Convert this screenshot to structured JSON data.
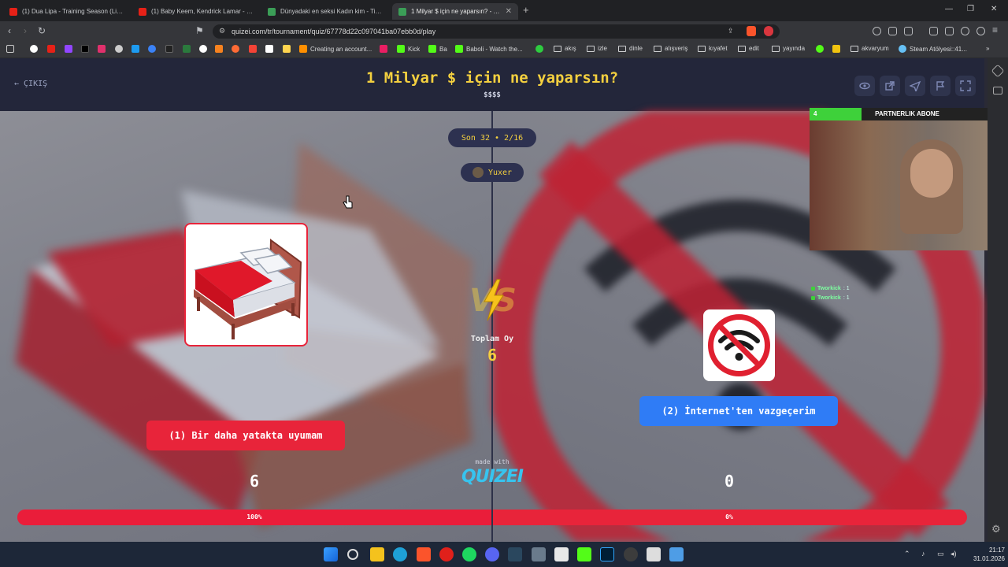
{
  "browser": {
    "tabs": [
      {
        "label": "(1) Dua Lipa - Training Season (Live f...",
        "active": false,
        "favicon_color": "#e62117"
      },
      {
        "label": "(1) Baby Keem, Kendrick Lamar - fam...",
        "active": false,
        "favicon_color": "#e62117"
      },
      {
        "label": "Dünyadaki en seksi Kadın kim - Tier l...",
        "active": false,
        "favicon_color": "#3b9e57"
      },
      {
        "label": "1 Milyar $ için ne yaparsın? - Tier",
        "active": true,
        "favicon_color": "#3b9e57"
      }
    ],
    "new_tab": "+",
    "url": "quizei.com/tr/tournament/quiz/67778d22c097041ba07ebb0d/play",
    "bookmarks": [
      {
        "label": "",
        "color": "#ffffff"
      },
      {
        "label": "",
        "color": "#e62117"
      },
      {
        "label": "",
        "color": "#9146ff"
      },
      {
        "label": "",
        "color": "#000000"
      },
      {
        "label": "",
        "color": "#e1306c"
      },
      {
        "label": "",
        "color": "#cccccc"
      },
      {
        "label": "",
        "color": "#1d9bf0"
      },
      {
        "label": "",
        "color": "#3b82f6"
      },
      {
        "label": "",
        "color": "#2b7a3d"
      },
      {
        "label": "",
        "color": "#000000"
      },
      {
        "label": "",
        "color": "#ffffff"
      },
      {
        "label": "",
        "color": "#f6821f"
      },
      {
        "label": "",
        "color": "#ff6b35"
      },
      {
        "label": "",
        "color": "#f44336"
      },
      {
        "label": "",
        "color": "#ffffff"
      },
      {
        "label": "",
        "color": "#ffd54f"
      },
      {
        "label": "Creating an account...",
        "color": "#ff8f00"
      },
      {
        "label": "",
        "color": "#e91e63"
      },
      {
        "label": "Kick",
        "color": "#53fc18"
      },
      {
        "label": "Ba",
        "color": "#53fc18"
      },
      {
        "label": "Baboli - Watch the...",
        "color": "#53fc18"
      },
      {
        "label": "",
        "color": "#2ecc40"
      },
      {
        "label": "akış",
        "folder": true
      },
      {
        "label": "izle",
        "folder": true
      },
      {
        "label": "dinle",
        "folder": true
      },
      {
        "label": "alışveriş",
        "folder": true
      },
      {
        "label": "kıyafet",
        "folder": true
      },
      {
        "label": "edit",
        "folder": true
      },
      {
        "label": "yayında",
        "folder": true
      },
      {
        "label": "",
        "color": "#53fc18"
      },
      {
        "label": "",
        "color": "#f1c40f"
      },
      {
        "label": "akvaryum",
        "folder": true
      },
      {
        "label": "Steam Atölyesi::41...",
        "color": "#66c0f4"
      }
    ]
  },
  "quiz": {
    "exit_label": "ÇIKIŞ",
    "title": "1 Milyar $ için ne yaparsın?",
    "subtitle": "$$$$",
    "round_label": "Son 32 • 2/16",
    "author": "Yuxer",
    "vs": "VS",
    "total_votes_label": "Toplam Oy",
    "total_votes": "6",
    "made_with": "made with",
    "logo": "QUIZEI",
    "left": {
      "label": "(1) Bir daha yatakta uyumam",
      "score": "6",
      "percent_label": "100%",
      "percent": 100,
      "color": "#e8243a"
    },
    "right": {
      "label": "(2) İnternet'ten vazgeçerim",
      "score": "0",
      "percent_label": "0%",
      "percent": 0,
      "color": "#2f7cf6"
    }
  },
  "stream": {
    "bar_left": "4",
    "bar_title": "PARTNERLIK ABONE",
    "bar_right": "15",
    "chat": [
      {
        "name": "Tworkick",
        "text": ": 1"
      },
      {
        "name": "Tworkick",
        "text": ": 1"
      }
    ]
  },
  "taskbar": {
    "time": "21:17",
    "date": "31.01.2026"
  }
}
